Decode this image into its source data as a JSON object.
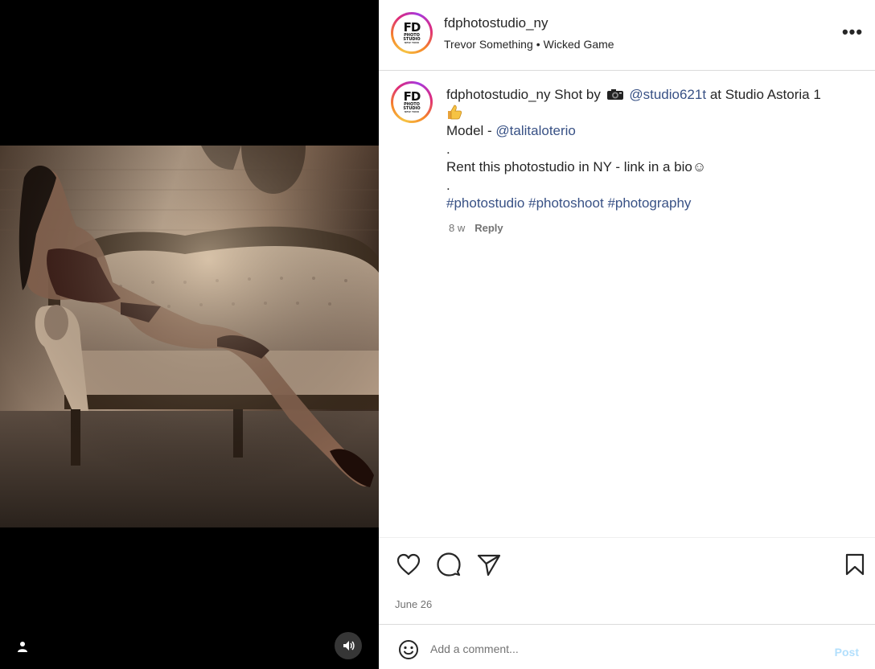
{
  "post": {
    "username": "fdphotostudio_ny",
    "audio": {
      "artist": "Trevor Something",
      "separator": "•",
      "track": "Wicked Game"
    },
    "more_label": "•••",
    "avatar_logo": {
      "main": "FD",
      "line1": "PHOTO",
      "line2": "STUDIO",
      "line3": "NEW YORK"
    }
  },
  "caption": {
    "username": "fdphotostudio_ny",
    "text_before_camera": "Shot by",
    "mention_photographer": "@studio621t",
    "text_after_mention": "at Studio Astoria 1",
    "model_label": "Model -",
    "mention_model": "@talitaloterio",
    "dot1": ".",
    "rent_text": "Rent this photostudio in NY - link in a bio",
    "smile": "☺",
    "dot2": ".",
    "hashtags": [
      "#photostudio",
      "#photoshoot",
      "#photography"
    ],
    "age_num": "8",
    "age_unit": "w",
    "reply_label": "Reply"
  },
  "actions": {
    "date": "June 26"
  },
  "comment_box": {
    "placeholder": "Add a comment...",
    "post_label": "Post"
  },
  "icons": {
    "like": "heart-icon",
    "comment": "comment-icon",
    "share": "paper-plane-icon",
    "save": "bookmark-icon",
    "emoji": "smiley-icon",
    "camera": "camera-icon",
    "thumb": "thumbs-up-icon",
    "user_tag": "user-icon",
    "audio": "speaker-icon"
  },
  "colors": {
    "link": "#385185",
    "muted": "#737373",
    "post_disabled": "#b2dffc",
    "border": "#dbdbdb"
  }
}
